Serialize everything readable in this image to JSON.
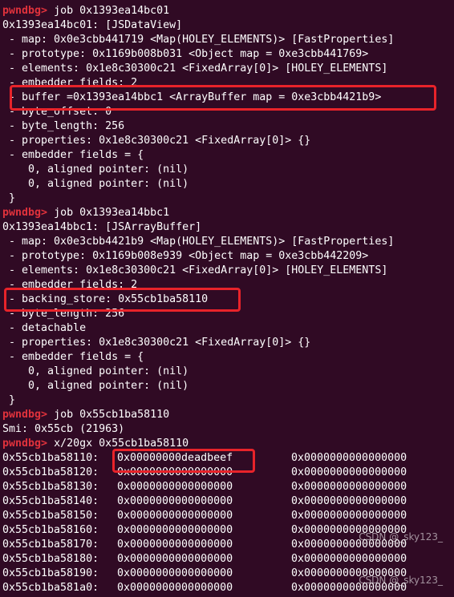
{
  "session": {
    "prompt": "pwndbg>",
    "blocks": [
      {
        "command": "job 0x1393ea14bc01",
        "lines": [
          "0x1393ea14bc01: [JSDataView]",
          " - map: 0x0e3cbb441719 <Map(HOLEY_ELEMENTS)> [FastProperties]",
          " - prototype: 0x1169b008b031 <Object map = 0xe3cbb441769>",
          " - elements: 0x1e8c30300c21 <FixedArray[0]> [HOLEY_ELEMENTS]",
          " - embedder fields: 2",
          " - buffer =0x1393ea14bbc1 <ArrayBuffer map = 0xe3cbb4421b9>",
          " - byte_offset: 0",
          " - byte_length: 256",
          " - properties: 0x1e8c30300c21 <FixedArray[0]> {}",
          " - embedder fields = {",
          "    0, aligned pointer: (nil)",
          "    0, aligned pointer: (nil)",
          " }"
        ]
      },
      {
        "command": "job 0x1393ea14bbc1",
        "lines": [
          "0x1393ea14bbc1: [JSArrayBuffer]",
          " - map: 0x0e3cbb4421b9 <Map(HOLEY_ELEMENTS)> [FastProperties]",
          " - prototype: 0x1169b008e939 <Object map = 0xe3cbb442209>",
          " - elements: 0x1e8c30300c21 <FixedArray[0]> [HOLEY_ELEMENTS]",
          " - embedder fields: 2",
          " - backing_store: 0x55cb1ba58110",
          " - byte_length: 256",
          " - detachable",
          " - properties: 0x1e8c30300c21 <FixedArray[0]> {}",
          " - embedder fields = {",
          "    0, aligned pointer: (nil)",
          "    0, aligned pointer: (nil)",
          " }"
        ]
      },
      {
        "command": "job 0x55cb1ba58110",
        "lines": [
          "Smi: 0x55cb (21963)"
        ]
      }
    ],
    "dump_command": "x/20gx 0x55cb1ba58110",
    "dump_rows": [
      {
        "addr": "0x55cb1ba58110:",
        "v1": "0x00000000deadbeef",
        "v2": "0x0000000000000000"
      },
      {
        "addr": "0x55cb1ba58120:",
        "v1": "0x0000000000000000",
        "v2": "0x0000000000000000"
      },
      {
        "addr": "0x55cb1ba58130:",
        "v1": "0x0000000000000000",
        "v2": "0x0000000000000000"
      },
      {
        "addr": "0x55cb1ba58140:",
        "v1": "0x0000000000000000",
        "v2": "0x0000000000000000"
      },
      {
        "addr": "0x55cb1ba58150:",
        "v1": "0x0000000000000000",
        "v2": "0x0000000000000000"
      },
      {
        "addr": "0x55cb1ba58160:",
        "v1": "0x0000000000000000",
        "v2": "0x0000000000000000"
      },
      {
        "addr": "0x55cb1ba58170:",
        "v1": "0x0000000000000000",
        "v2": "0x0000000000000000"
      },
      {
        "addr": "0x55cb1ba58180:",
        "v1": "0x0000000000000000",
        "v2": "0x0000000000000000"
      },
      {
        "addr": "0x55cb1ba58190:",
        "v1": "0x0000000000000000",
        "v2": "0x0000000000000000"
      },
      {
        "addr": "0x55cb1ba581a0:",
        "v1": "0x0000000000000000",
        "v2": "0x0000000000000000"
      }
    ]
  },
  "watermark": "CSDN @_sky123_",
  "colors": {
    "background": "#300a24",
    "prompt": "#e0323c",
    "text": "#ffffff",
    "highlight_box": "#e8232a"
  }
}
